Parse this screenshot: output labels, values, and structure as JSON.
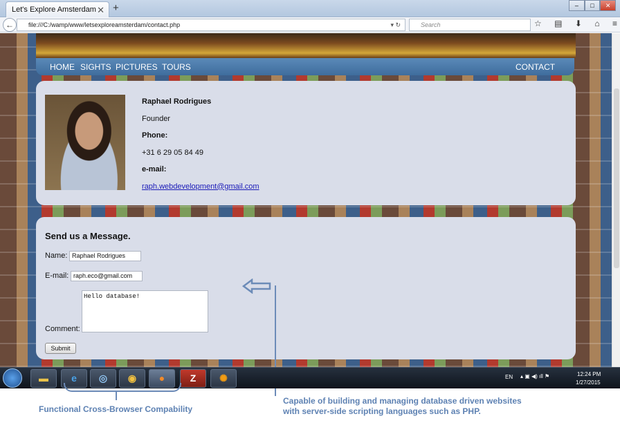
{
  "browser": {
    "tab_title": "Let's Explore Amsterdam",
    "url": "file:///C:/wamp/www/letsexploreamsterdam/contact.php",
    "search_placeholder": "Search"
  },
  "site_nav": {
    "items": [
      "HOME",
      "SIGHTS",
      "PICTURES",
      "TOURS"
    ],
    "contact": "CONTACT"
  },
  "contact_card": {
    "name": "Raphael Rodrigues",
    "role": "Founder",
    "phone_label": "Phone:",
    "phone": "+31 6 29 05 84 49",
    "email_label": "e-mail:",
    "email": "raph.webdevelopment@gmail.com"
  },
  "message_form": {
    "title": "Send us a Message.",
    "name_label": "Name:",
    "name_value": "Raphael Rodrigues",
    "email_label": "E-mail:",
    "email_value": "raph.eco@gmail.com",
    "comment_label": "Comment:",
    "comment_value": "Hello database!",
    "submit_label": "Submit"
  },
  "taskbar": {
    "lang": "EN",
    "time": "12:24 PM",
    "date": "1/27/2015",
    "apps": [
      "ie-icon",
      "safari-icon",
      "chrome-icon",
      "firefox-icon",
      "filezilla-icon",
      "wamp-icon"
    ]
  },
  "annotations": {
    "left_caption": "Functional Cross-Browser Compability",
    "right_caption_line1": "Capable of building and managing database driven websites",
    "right_caption_line2": "with server-side scripting languages such as PHP."
  },
  "colors": {
    "accent": "#5e82b3",
    "nav_bar": "#4a7aab",
    "card_bg": "#d9dde9"
  }
}
